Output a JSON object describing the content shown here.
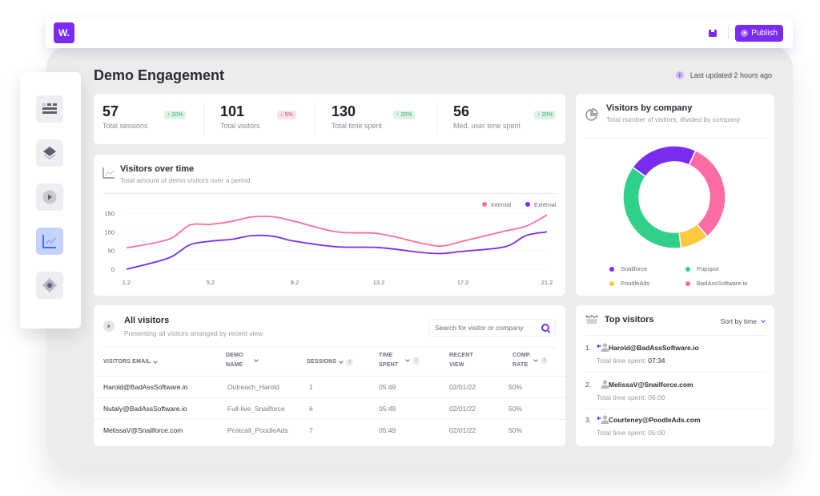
{
  "app": {
    "logo_text": "W.",
    "publish_label": "Publish",
    "save_icon": "save-icon"
  },
  "sidebar": {
    "items": [
      {
        "name": "dashboard",
        "icon": "list-grid-icon",
        "active": false
      },
      {
        "name": "layers",
        "icon": "layers-icon",
        "active": false
      },
      {
        "name": "demos",
        "icon": "play-icon",
        "active": false
      },
      {
        "name": "analytics",
        "icon": "chart-line-icon",
        "active": true
      },
      {
        "name": "settings",
        "icon": "gear-icon",
        "active": false
      }
    ]
  },
  "page": {
    "title": "Demo Engagement",
    "updated": "Last updated 2 hours ago",
    "info_glyph": "i"
  },
  "stats": [
    {
      "value": "57",
      "label": "Total sessions",
      "change": "20%",
      "direction": "up"
    },
    {
      "value": "101",
      "label": "Total visitors",
      "change": "5%",
      "direction": "down"
    },
    {
      "value": "130",
      "label": "Total time spent",
      "change": "20%",
      "direction": "up"
    },
    {
      "value": "56",
      "label": "Med. user time spent",
      "change": "20%",
      "direction": "up"
    }
  ],
  "colors": {
    "accent": "#7b2cf3",
    "internal": "#ff6ba6",
    "external": "#7b2cf3",
    "snailforce": "#7b2cf3",
    "pupspot": "#2fd08a",
    "poodleads": "#ffc93f",
    "badass": "#ff6ba6",
    "up": "#3aa86a",
    "down": "#e0485a"
  },
  "visitors_chart": {
    "title": "Visitors over time",
    "subtitle": "Total amount of demo visitors over a period"
  },
  "company_chart": {
    "title": "Visitors by company",
    "subtitle": "Total number of visitors, divided by company"
  },
  "chart_data": [
    {
      "type": "line",
      "title": "Visitors over time",
      "xlabel": "",
      "ylabel": "",
      "x": [
        1.2,
        3.2,
        4.2,
        5.2,
        6.2,
        7.2,
        8.2,
        9.2,
        11.2,
        13.2,
        15.2,
        16.2,
        17.2,
        19.2,
        20.2,
        21.2
      ],
      "x_ticks": [
        "1.2",
        "5.2",
        "9.2",
        "13.2",
        "17.2",
        "21.2"
      ],
      "y_ticks": [
        "0",
        "50",
        "100",
        "150"
      ],
      "ylim": [
        0,
        150
      ],
      "xlim": [
        1.2,
        21.2
      ],
      "grid": true,
      "legend": "top-right",
      "series": [
        {
          "name": "Internal",
          "color": "#ff6ba6",
          "values": [
            57,
            80,
            118,
            120,
            128,
            140,
            140,
            128,
            100,
            95,
            70,
            62,
            75,
            102,
            115,
            145
          ]
        },
        {
          "name": "External",
          "color": "#7b2cf3",
          "values": [
            0,
            30,
            65,
            75,
            80,
            90,
            88,
            75,
            60,
            58,
            45,
            42,
            48,
            60,
            90,
            100
          ]
        }
      ]
    },
    {
      "type": "pie",
      "title": "Visitors by company",
      "subtitle": "Total number of visitors, divided by company",
      "legend": "bottom",
      "donut": true,
      "categories": [
        "Snailforce",
        "BadAssSoftware.io",
        "PoodleAds",
        "Pupspot"
      ],
      "values": [
        22,
        32,
        9,
        37
      ],
      "colors": [
        "#7b2cf3",
        "#ff6ba6",
        "#ffc93f",
        "#2fd08a"
      ],
      "legend_order": [
        "Snailforce",
        "Pupspot",
        "PoodleAds",
        "BadAssSoftware.io"
      ]
    }
  ],
  "visitors_table": {
    "title": "All visitors",
    "subtitle": "Presenting all visitors arranged by recent view",
    "search_placeholder": "Search for visitor or company",
    "columns": [
      {
        "label": "VISITORS EMAIL",
        "sortable": true,
        "info": false
      },
      {
        "label": "DEMO\nNAME",
        "sortable": true,
        "info": false
      },
      {
        "label": "SESSIONS",
        "sortable": true,
        "info": true
      },
      {
        "label": "TIME\nSPENT",
        "sortable": true,
        "info": true
      },
      {
        "label": "RECENT\nVIEW",
        "sortable": false,
        "info": false
      },
      {
        "label": "COMP.\nRATE",
        "sortable": true,
        "info": true
      }
    ],
    "rows": [
      {
        "email": "Harold@BadAssSoftware.io",
        "demo": "Outreach_Harold",
        "sessions": "1",
        "time": "05:49",
        "recent": "02/01/22",
        "rate": "50%"
      },
      {
        "email": "Nutaly@BadAssSoftware.io",
        "demo": "Full-live_Snailforce",
        "sessions": "6",
        "time": "05:49",
        "recent": "02/01/22",
        "rate": "50%"
      },
      {
        "email": "MelissaV@Snailforce.com",
        "demo": "Postcall_PoodleAds",
        "sessions": "7",
        "time": "05:49",
        "recent": "02/01/22",
        "rate": "50%"
      }
    ]
  },
  "top_visitors": {
    "title": "Top visitors",
    "sort_label": "Sort by time",
    "time_prefix": "Total time spent: ",
    "items": [
      {
        "rank": "1.",
        "email": "Harold@BadAssSoftware.io",
        "time": "07:34",
        "arrow": true
      },
      {
        "rank": "2.",
        "email": "MelissaV@Snailforce.com",
        "time": "06:00",
        "arrow": false
      },
      {
        "rank": "3.",
        "email": "Courteney@PoodleAds.com",
        "time": "05:00",
        "arrow": true
      }
    ]
  }
}
